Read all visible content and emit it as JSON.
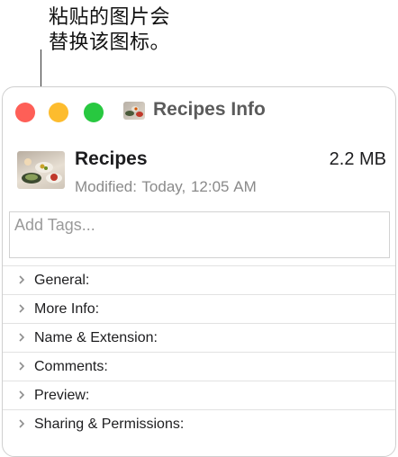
{
  "callout": {
    "line1": "粘贴的图片会",
    "line2": "替换该图标。"
  },
  "window": {
    "title": "Recipes Info"
  },
  "file": {
    "name": "Recipes",
    "size": "2.2 MB",
    "modified_label": "Modified:",
    "modified_value": "Today, 12:05 AM"
  },
  "tags": {
    "placeholder": "Add Tags..."
  },
  "sections": [
    "General:",
    "More Info:",
    "Name & Extension:",
    "Comments:",
    "Preview:",
    "Sharing & Permissions:"
  ],
  "colors": {
    "close": "#fe5f57",
    "minimize": "#fdbc2e",
    "zoom": "#28c840"
  }
}
